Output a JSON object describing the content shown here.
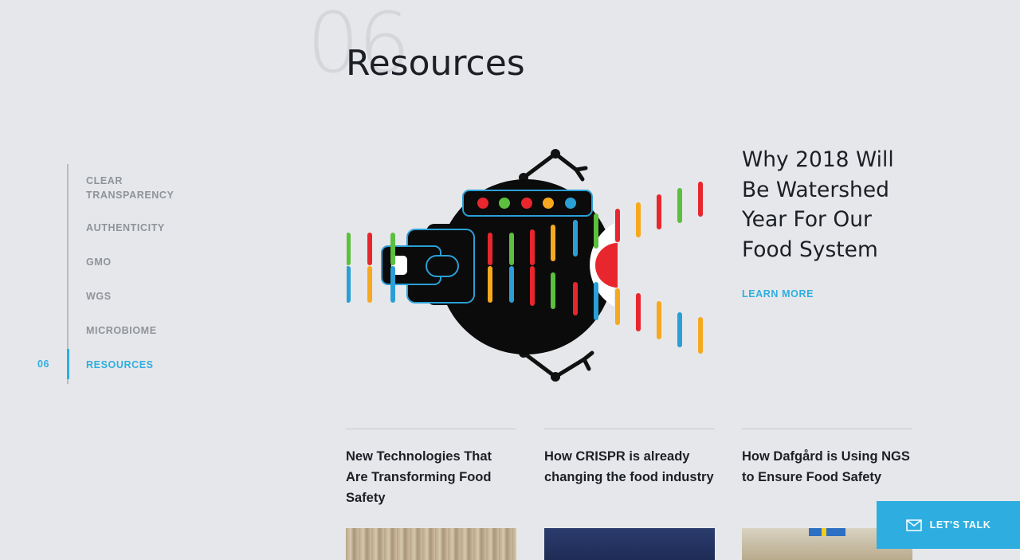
{
  "header": {
    "section_number": "06",
    "title": "Resources"
  },
  "side_nav": {
    "active_number": "06",
    "items": [
      {
        "label": "CLEAR TRANSPARENCY"
      },
      {
        "label": "AUTHENTICITY"
      },
      {
        "label": "GMO"
      },
      {
        "label": "WGS"
      },
      {
        "label": "MICROBIOME"
      },
      {
        "label": "RESOURCES"
      }
    ]
  },
  "feature": {
    "title": "Why 2018 Will Be Watershed Year For Our Food System",
    "cta_label": "LEARN MORE"
  },
  "cards": [
    {
      "title": "New Technologies That Are Transforming Food Safety"
    },
    {
      "title": "How CRISPR is already changing the food industry"
    },
    {
      "title": "How Dafgård is Using NGS to Ensure Food Safety"
    }
  ],
  "contact_button": {
    "label": "LET'S TALK",
    "icon": "mail-icon"
  },
  "colors": {
    "accent": "#2eaee0",
    "background": "#e6e7ea",
    "text": "#1d1f26"
  }
}
